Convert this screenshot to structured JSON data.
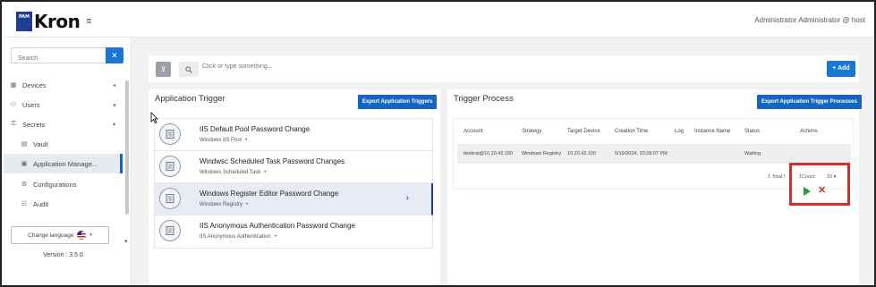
{
  "header": {
    "logo_badge": "PAM",
    "logo_text": "Kron",
    "menu_icon": "hamburger-icon",
    "user": "Administrator Administrator @ host"
  },
  "sidebar": {
    "search_placeholder": "Search",
    "clear_label": "✕",
    "items": [
      {
        "label": "Devices",
        "icon": "devices-icon"
      },
      {
        "label": "Users",
        "icon": "users-icon"
      },
      {
        "label": "Secrets",
        "icon": "lock-icon"
      },
      {
        "label": "Vault",
        "icon": "vault-icon"
      },
      {
        "label": "Application Manage...",
        "icon": "application-icon"
      },
      {
        "label": "Configurations",
        "icon": "configurations-icon"
      },
      {
        "label": "Audit",
        "icon": "audit-icon"
      }
    ],
    "language_button": "Change language",
    "version": "Version : 3.5.0"
  },
  "toolbar": {
    "search_placeholder": "Click or type something...",
    "add_label": "Add"
  },
  "application_trigger": {
    "title": "Application Trigger",
    "export_label": "Export Application Triggers",
    "triggers": [
      {
        "name": "IIS Default Pool Password Change",
        "type": "Windows IIS Pool"
      },
      {
        "name": "Windwsc Scheduled Task Password Changes",
        "type": "Windows Scheduled Task"
      },
      {
        "name": "Windows Register Editor Password Change",
        "type": "Windows Registry"
      },
      {
        "name": "IIS Anonymous Authentication Password Change",
        "type": "IIS Anonymous Authentication"
      }
    ],
    "selected_index": 2
  },
  "trigger_process": {
    "title": "Trigger Process",
    "export_label": "Export Application Trigger Processes",
    "columns": [
      "Account",
      "Strategy",
      "Target Device",
      "Creation Time",
      "Log",
      "Instance Name",
      "Status",
      "Actions"
    ],
    "rows": [
      {
        "account": "tknkiral@10.20.42.150",
        "strategy": "Windows Registry",
        "target_device": "10.20.42.150",
        "creation_time": "5/19/2024, 10:28:07 PM",
        "log": "",
        "instance_name": "",
        "status": "Waiting"
      }
    ],
    "pager": {
      "total": "1 Total f",
      "count": "1Count",
      "page_size": "10"
    }
  },
  "colors": {
    "accent": "#1976d2",
    "brand": "#1e3f8f",
    "highlight": "#d32f2f",
    "play": "#2e9b3a"
  }
}
